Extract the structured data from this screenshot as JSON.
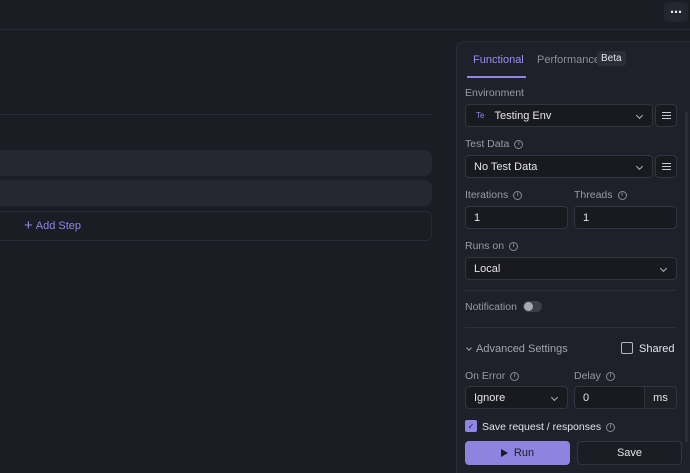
{
  "topbar": {
    "more_icon": "⋯"
  },
  "editor": {
    "add_step_label": "Add Step",
    "add_step_icon": "+"
  },
  "panel": {
    "tabs": [
      {
        "label": "Functional",
        "active": true
      },
      {
        "label": "Performance",
        "active": false,
        "badge": "Beta"
      }
    ],
    "environment": {
      "label": "Environment",
      "badge": "Te",
      "value": "Testing Env"
    },
    "test_data": {
      "label": "Test Data",
      "value": "No Test Data"
    },
    "iterations": {
      "label": "Iterations",
      "value": "1"
    },
    "threads": {
      "label": "Threads",
      "value": "1"
    },
    "runs_on": {
      "label": "Runs on",
      "value": "Local"
    },
    "notification": {
      "label": "Notification",
      "enabled": false
    },
    "advanced": {
      "label": "Advanced Settings",
      "shared_label": "Shared",
      "shared_checked": false
    },
    "on_error": {
      "label": "On Error",
      "value": "Ignore"
    },
    "delay": {
      "label": "Delay",
      "value": "0",
      "unit": "ms"
    },
    "save_responses": {
      "label": "Save request / responses",
      "checked": true
    },
    "run_label": "Run",
    "save_label": "Save"
  },
  "colors": {
    "accent": "#8f86e6",
    "background": "#1c1c24",
    "panel": "#20202a"
  }
}
